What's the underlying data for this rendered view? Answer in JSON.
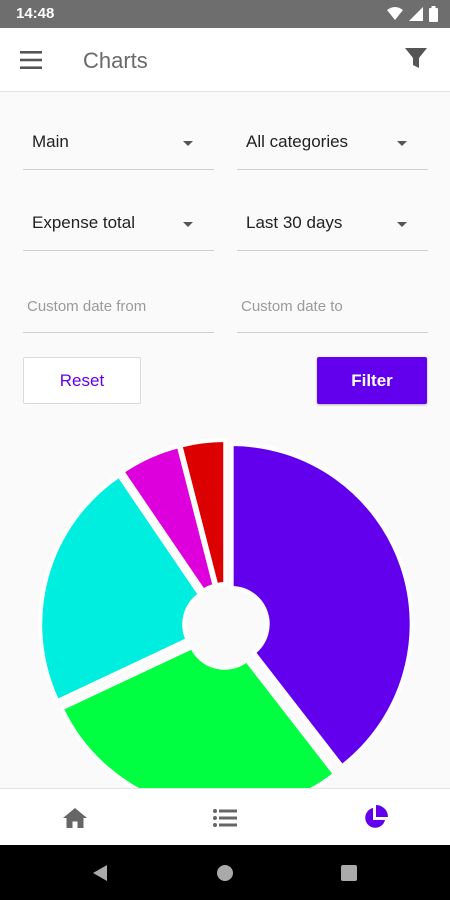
{
  "status_bar": {
    "time": "14:48"
  },
  "app_bar": {
    "title": "Charts"
  },
  "filters": {
    "account": "Main",
    "category": "All categories",
    "chart_type": "Expense total",
    "period": "Last 30 days",
    "custom_date_from_placeholder": "Custom date from",
    "custom_date_to_placeholder": "Custom date to",
    "reset_label": "Reset",
    "filter_label": "Filter"
  },
  "colors": {
    "accent": "#6200ee"
  },
  "icons": {
    "menu": "menu-icon",
    "filter": "filter-icon",
    "home": "home-icon",
    "list": "list-icon",
    "chart": "pie-chart-icon"
  },
  "bottom_nav": {
    "active": "charts"
  },
  "chart_data": {
    "type": "pie",
    "title": "",
    "series": [
      {
        "value": 39.5,
        "color": "#6200ee"
      },
      {
        "value": 28.5,
        "color": "#00ff40"
      },
      {
        "value": 22.5,
        "color": "#00eee0"
      },
      {
        "value": 5.5,
        "color": "#dd00dd"
      },
      {
        "value": 4.0,
        "color": "#dd0000"
      }
    ]
  }
}
